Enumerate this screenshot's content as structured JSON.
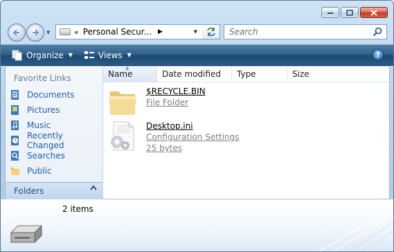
{
  "window": {
    "caption_buttons": [
      "minimize",
      "maximize",
      "close"
    ]
  },
  "address": {
    "chevron": "«",
    "path": "Personal Secur...",
    "arrow": "▶",
    "dropdown": "▼"
  },
  "search": {
    "placeholder": "Search"
  },
  "toolbar": {
    "organize_label": "Organize",
    "views_label": "Views",
    "dropdown_arrow": "▼",
    "help_glyph": "?"
  },
  "nav": {
    "heading": "Favorite Links",
    "items": [
      {
        "label": "Documents",
        "icon": "documents-icon"
      },
      {
        "label": "Pictures",
        "icon": "pictures-icon"
      },
      {
        "label": "Music",
        "icon": "music-icon"
      },
      {
        "label": "Recently Changed",
        "icon": "recently-changed-icon"
      },
      {
        "label": "Searches",
        "icon": "searches-icon"
      },
      {
        "label": "Public",
        "icon": "public-folder-icon"
      }
    ],
    "folders_label": "Folders",
    "folders_chevron": "⌃"
  },
  "columns": {
    "name": "Name",
    "date": "Date modified",
    "type": "Type",
    "size": "Size",
    "sort_glyph": "▲"
  },
  "files": [
    {
      "name": "$RECYCLE.BIN",
      "type": "File Folder",
      "size": "",
      "icon": "folder-icon"
    },
    {
      "name": "Desktop.ini",
      "type": "Configuration Settings",
      "size": "25 bytes",
      "icon": "settings-file-icon"
    }
  ],
  "details": {
    "count": "2 items",
    "icon": "drive-icon"
  },
  "colors": {
    "link": "#1e5fae",
    "toolbar": "#2f5f88",
    "close": "#c23a22"
  }
}
